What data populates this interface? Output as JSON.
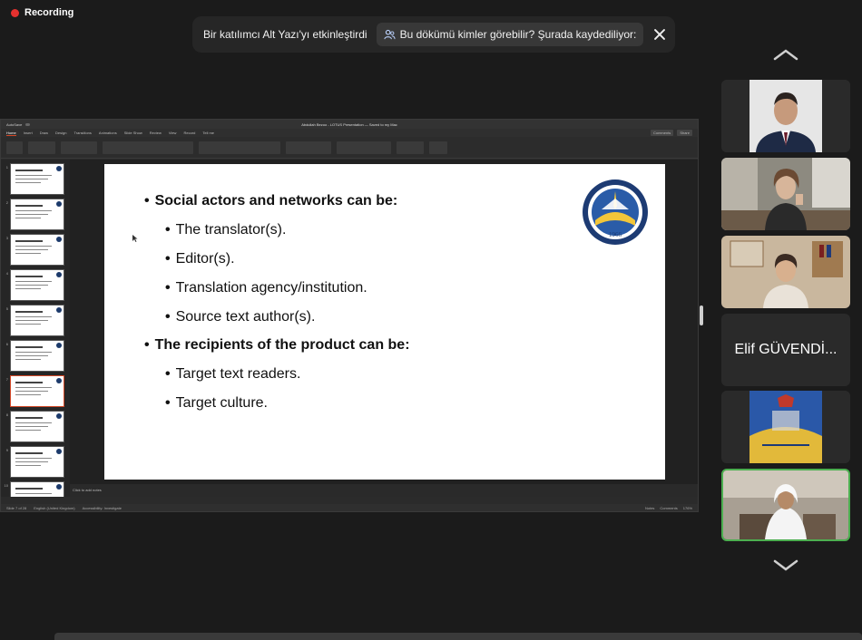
{
  "recording": {
    "label": "Recording",
    "color": "#e5312f"
  },
  "banner": {
    "message": "Bir katılımcı Alt Yazı'yı etkinleştirdi",
    "visibility_text": "Bu dökümü kimler görebilir? Şurada kaydediliyor:"
  },
  "ppt": {
    "title": "Abdullah Bezoo - LOTUS Presentation — Saved to my Mac",
    "autosave": "AutoSave",
    "menu": [
      "Home",
      "Insert",
      "Draw",
      "Design",
      "Transitions",
      "Animations",
      "Slide Show",
      "Review",
      "View",
      "Record",
      "Tell me"
    ],
    "menu_right": [
      "Comments",
      "Share"
    ],
    "notes_placeholder": "Click to add notes",
    "status_left": [
      "Slide 7 of 28",
      "English (United Kingdom)",
      "Accessibility: Investigate"
    ],
    "status_right": [
      "Notes",
      "Comments",
      "176%"
    ],
    "thumb_numbers": [
      "1",
      "2",
      "3",
      "4",
      "5",
      "6",
      "7",
      "8",
      "9",
      "10"
    ],
    "selected_thumb": 7
  },
  "slide": {
    "bullets": [
      {
        "level": 1,
        "text": "Social actors and networks can be:"
      },
      {
        "level": 2,
        "text": "The translator(s)."
      },
      {
        "level": 2,
        "text": "Editor(s)."
      },
      {
        "level": 2,
        "text": "Translation agency/institution."
      },
      {
        "level": 2,
        "text": "Source text author(s)."
      },
      {
        "level": 1,
        "text": "The recipients of the product can be:"
      },
      {
        "level": 2,
        "text": "Target text readers."
      },
      {
        "level": 2,
        "text": "Target culture."
      }
    ],
    "seal_year": "1966"
  },
  "participants": [
    {
      "kind": "video",
      "desc": "man-suit"
    },
    {
      "kind": "video",
      "desc": "woman-desk"
    },
    {
      "kind": "video",
      "desc": "woman-office"
    },
    {
      "kind": "name",
      "name": "Elif GÜVENDİ..."
    },
    {
      "kind": "logo",
      "desc": "academy-logo"
    },
    {
      "kind": "video",
      "desc": "man-ghutra",
      "active": true
    }
  ],
  "colors": {
    "active_speaker": "#4caf50",
    "accent": "#d24726"
  }
}
